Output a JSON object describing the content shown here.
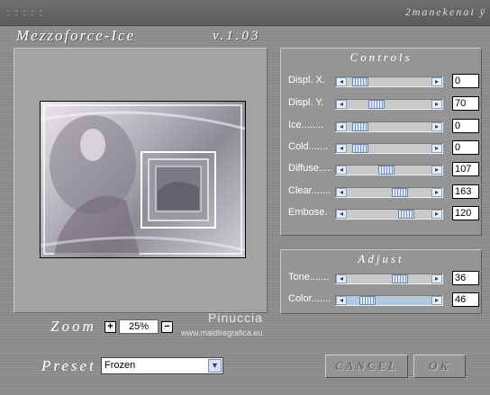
{
  "header": {
    "title": "Mezzoforce-Ice",
    "version": "v.1.03",
    "vendor": "2manekenai ÿ"
  },
  "controls": {
    "title": "Controls",
    "sliders": [
      {
        "label": "Displ. X.",
        "value": "0",
        "level": 0.18
      },
      {
        "label": "Displ. Y.",
        "value": "70",
        "level": 0.36
      },
      {
        "label": "Ice........",
        "value": "0",
        "level": 0.18
      },
      {
        "label": "Cold.......",
        "value": "0",
        "level": 0.18
      },
      {
        "label": "Diffuse.....",
        "value": "107",
        "level": 0.48
      },
      {
        "label": "Clear.......",
        "value": "163",
        "level": 0.64
      },
      {
        "label": "Embose.",
        "value": "120",
        "level": 0.7
      }
    ]
  },
  "adjust": {
    "title": "Adjust",
    "sliders": [
      {
        "label": "Tone.......",
        "value": "36",
        "level": 0.64
      },
      {
        "label": "Color.......",
        "value": "46",
        "level": 0.26
      }
    ]
  },
  "zoom": {
    "label": "Zoom",
    "value": "25%",
    "plus": "+",
    "minus": "−"
  },
  "preset": {
    "label": "Preset",
    "selected": "Frozen"
  },
  "buttons": {
    "cancel": "CANCEL",
    "ok": "OK"
  },
  "watermark": {
    "name": "Pinuccia",
    "url": "www.maidiregrafica.eu"
  },
  "icons": {
    "left_arrow": "◂",
    "right_arrow": "▸",
    "dropdown": "▼"
  }
}
